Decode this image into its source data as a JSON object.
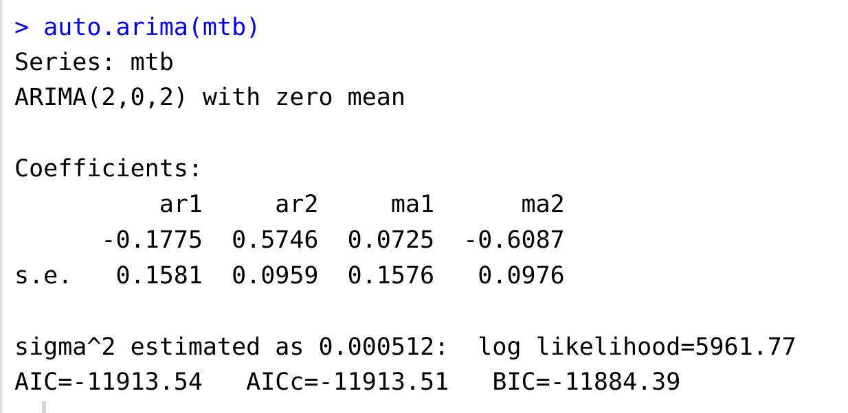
{
  "console": {
    "command": "> auto.arima(mtb)",
    "series_line": "Series: mtb",
    "model_line": "ARIMA(2,0,2) with zero mean",
    "coefficients_heading": "Coefficients:",
    "coef_header_row": "          ar1     ar2     ma1      ma2",
    "coef_value_row": "      -0.1775  0.5746  0.0725  -0.6087",
    "coef_se_row": "s.e.   0.1581  0.0959  0.1576   0.0976",
    "sigma_line": "sigma^2 estimated as 0.000512:  log likelihood=5961.77",
    "ic_line": "AIC=-11913.54   AICc=-11913.51   BIC=-11884.39"
  },
  "colors": {
    "command": "#0000ff",
    "output": "#000000",
    "gutter": "#dcdcdc"
  }
}
